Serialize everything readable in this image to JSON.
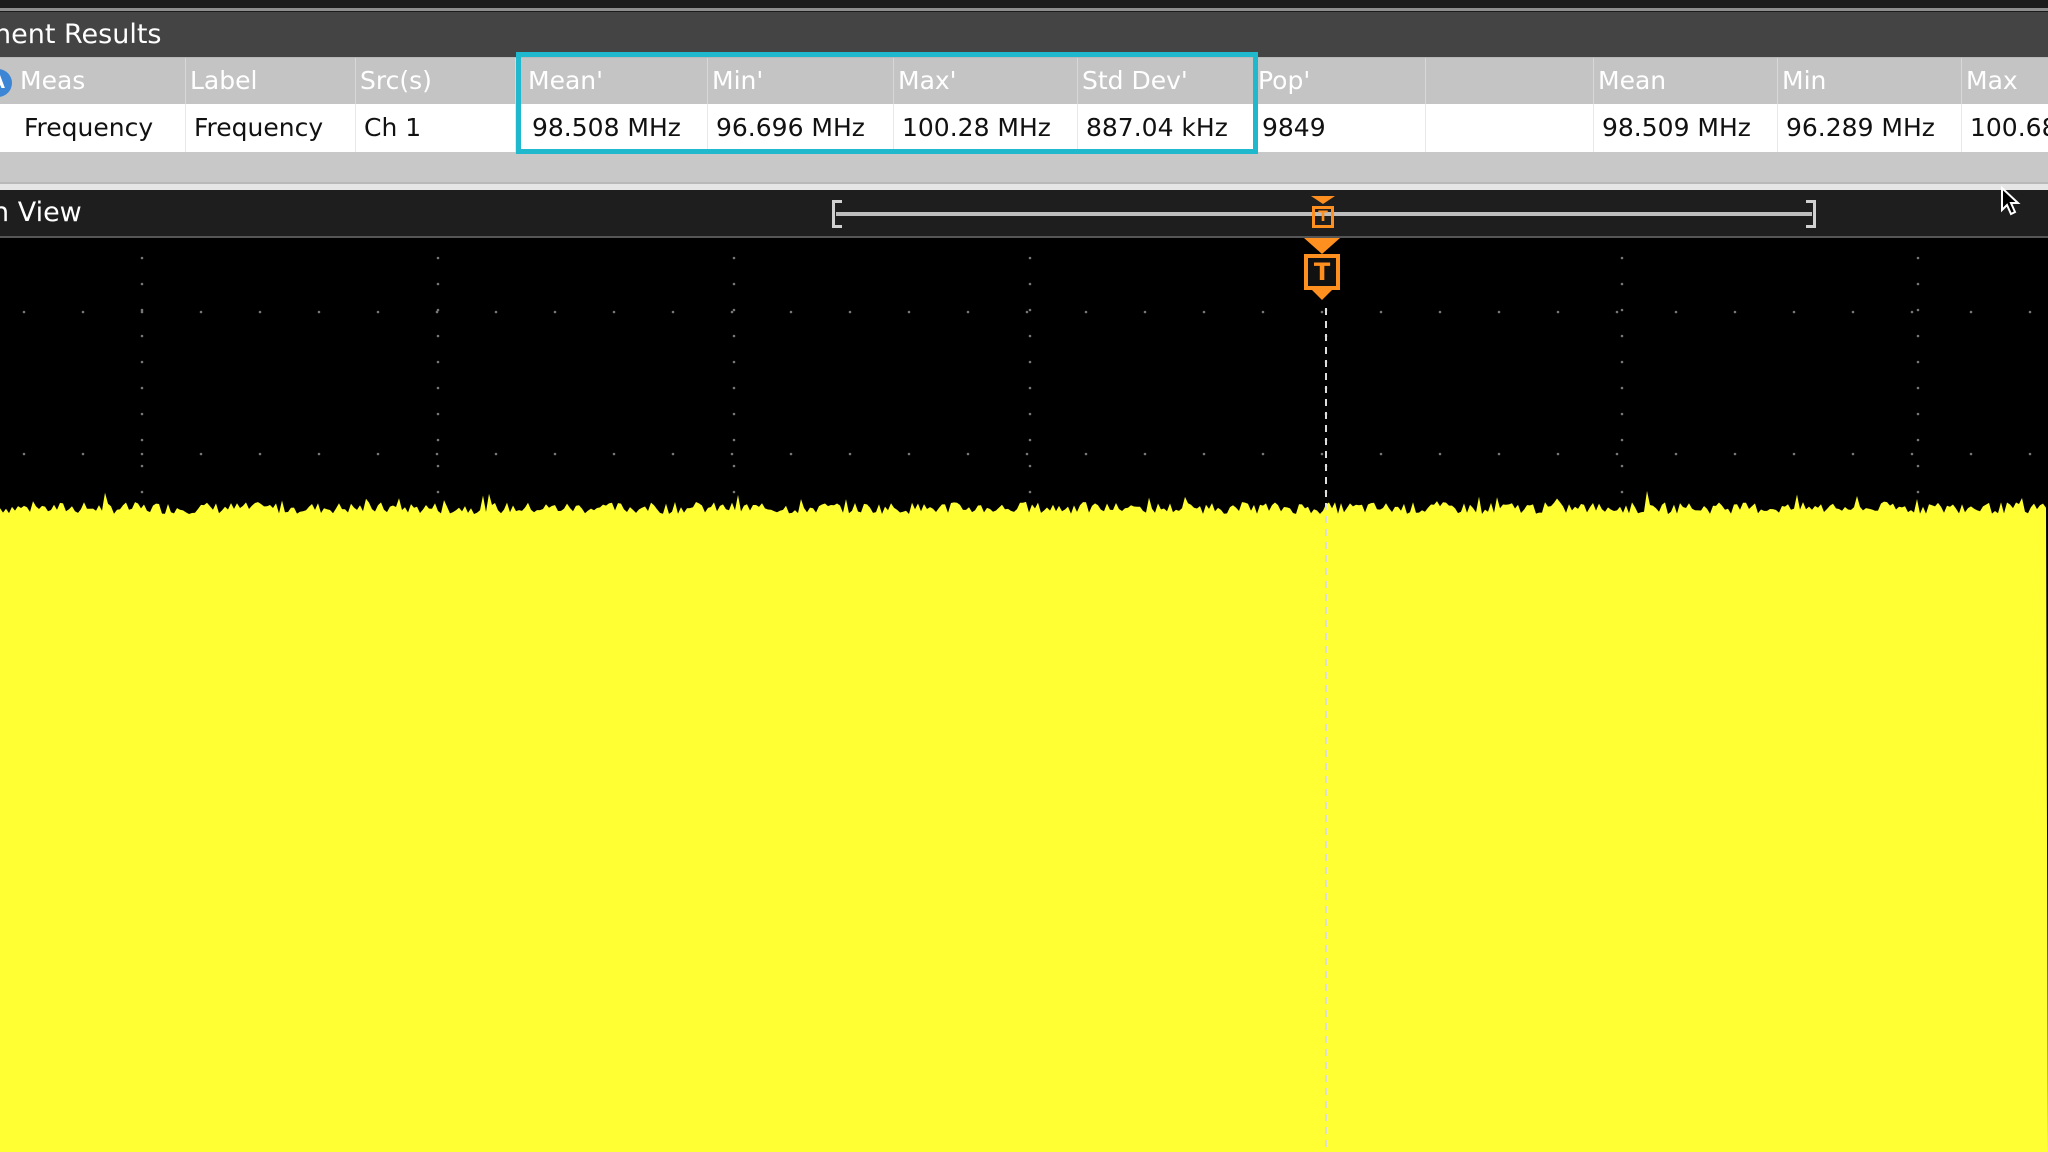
{
  "measurement_results": {
    "title": "nent Results",
    "badge": "A",
    "columns": [
      "Meas",
      "Label",
      "Src(s)",
      "Mean'",
      "Min'",
      "Max'",
      "Std Dev'",
      "Pop'",
      "",
      "Mean",
      "Min",
      "Max"
    ],
    "row": [
      "Frequency",
      "Frequency",
      "Ch 1",
      "98.508 MHz",
      "96.696 MHz",
      "100.28 MHz",
      "887.04 kHz",
      "9849",
      "",
      "98.509 MHz",
      "96.289 MHz",
      "100.68"
    ]
  },
  "waveform_view": {
    "title": "n View",
    "trigger_label": "T"
  },
  "colors": {
    "waveform": "#ffff33",
    "trigger": "#ff9020",
    "highlight": "#20b8cc",
    "badge": "#3d86d6"
  }
}
